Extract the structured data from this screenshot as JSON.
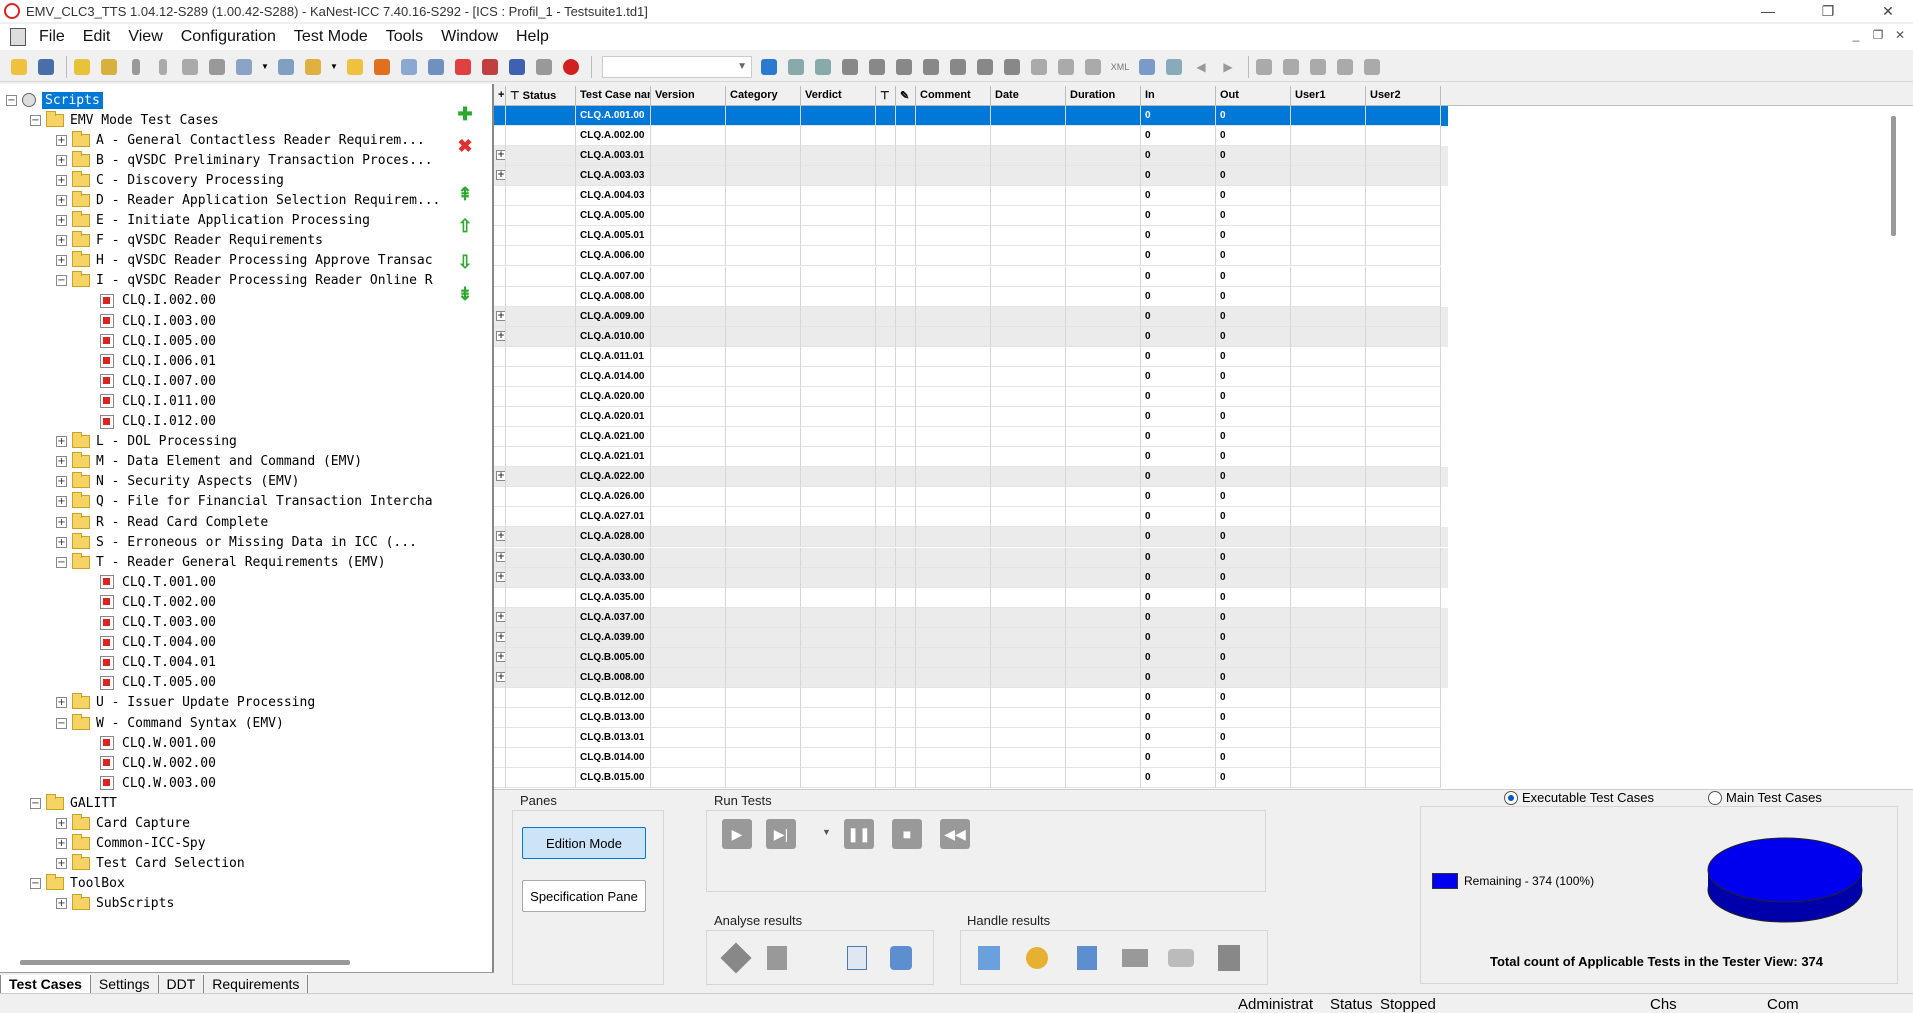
{
  "window": {
    "title": "EMV_CLC3_TTS 1.04.12-S289 (1.00.42-S288)  - KaNest-ICC 7.40.16-S292 - [ICS : Profil_1 - Testsuite1.td1]",
    "controls": {
      "minimize": "—",
      "maximize": "❐",
      "close": "✕"
    }
  },
  "menu": [
    "File",
    "Edit",
    "View",
    "Configuration",
    "Test Mode",
    "Tools",
    "Window",
    "Help"
  ],
  "mdi_controls": {
    "minimize": "_",
    "restore": "❐",
    "close": "✕"
  },
  "toolbar": {
    "combo_value": "",
    "combo_arrow": "▼"
  },
  "tree": {
    "root": "Scripts",
    "nodes": [
      {
        "label": "EMV Mode Test Cases",
        "level": 1,
        "kind": "folder",
        "toggle": "-"
      },
      {
        "label": "A - General Contactless Reader Requirem...",
        "level": 2,
        "kind": "folder",
        "toggle": "+"
      },
      {
        "label": "B - qVSDC Preliminary Transaction Proces...",
        "level": 2,
        "kind": "folder",
        "toggle": "+"
      },
      {
        "label": "C - Discovery Processing",
        "level": 2,
        "kind": "folder",
        "toggle": "+"
      },
      {
        "label": "D - Reader Application Selection Requirem...",
        "level": 2,
        "kind": "folder",
        "toggle": "+"
      },
      {
        "label": "E - Initiate Application Processing",
        "level": 2,
        "kind": "folder",
        "toggle": "+"
      },
      {
        "label": "F - qVSDC Reader Requirements",
        "level": 2,
        "kind": "folder",
        "toggle": "+"
      },
      {
        "label": "H - qVSDC Reader Processing Approve Transac",
        "level": 2,
        "kind": "folder",
        "toggle": "+"
      },
      {
        "label": "I - qVSDC Reader Processing Reader Online R",
        "level": 2,
        "kind": "folder",
        "toggle": "-"
      },
      {
        "label": "CLQ.I.002.00",
        "level": 3,
        "kind": "script"
      },
      {
        "label": "CLQ.I.003.00",
        "level": 3,
        "kind": "script"
      },
      {
        "label": "CLQ.I.005.00",
        "level": 3,
        "kind": "script"
      },
      {
        "label": "CLQ.I.006.01",
        "level": 3,
        "kind": "script"
      },
      {
        "label": "CLQ.I.007.00",
        "level": 3,
        "kind": "script"
      },
      {
        "label": "CLQ.I.011.00",
        "level": 3,
        "kind": "script"
      },
      {
        "label": "CLQ.I.012.00",
        "level": 3,
        "kind": "script"
      },
      {
        "label": "L - DOL Processing",
        "level": 2,
        "kind": "folder",
        "toggle": "+"
      },
      {
        "label": "M - Data Element and Command (EMV)",
        "level": 2,
        "kind": "folder",
        "toggle": "+"
      },
      {
        "label": "N - Security Aspects (EMV)",
        "level": 2,
        "kind": "folder",
        "toggle": "+"
      },
      {
        "label": "Q - File for Financial Transaction Intercha",
        "level": 2,
        "kind": "folder",
        "toggle": "+"
      },
      {
        "label": "R - Read Card Complete",
        "level": 2,
        "kind": "folder",
        "toggle": "+"
      },
      {
        "label": "S - Erroneous or Missing Data in ICC (...",
        "level": 2,
        "kind": "folder",
        "toggle": "+"
      },
      {
        "label": "T - Reader General Requirements (EMV)",
        "level": 2,
        "kind": "folder",
        "toggle": "-"
      },
      {
        "label": "CLQ.T.001.00",
        "level": 3,
        "kind": "script"
      },
      {
        "label": "CLQ.T.002.00",
        "level": 3,
        "kind": "script"
      },
      {
        "label": "CLQ.T.003.00",
        "level": 3,
        "kind": "script"
      },
      {
        "label": "CLQ.T.004.00",
        "level": 3,
        "kind": "script"
      },
      {
        "label": "CLQ.T.004.01",
        "level": 3,
        "kind": "script"
      },
      {
        "label": "CLQ.T.005.00",
        "level": 3,
        "kind": "script"
      },
      {
        "label": "U - Issuer Update Processing",
        "level": 2,
        "kind": "folder",
        "toggle": "+"
      },
      {
        "label": "W - Command Syntax (EMV)",
        "level": 2,
        "kind": "folder",
        "toggle": "-"
      },
      {
        "label": "CLQ.W.001.00",
        "level": 3,
        "kind": "script"
      },
      {
        "label": "CLQ.W.002.00",
        "level": 3,
        "kind": "script"
      },
      {
        "label": "CLQ.W.003.00",
        "level": 3,
        "kind": "script"
      },
      {
        "label": "GALITT",
        "level": 1,
        "kind": "folder",
        "toggle": "-"
      },
      {
        "label": "Card Capture",
        "level": 2,
        "kind": "folder",
        "toggle": "+"
      },
      {
        "label": "Common-ICC-Spy",
        "level": 2,
        "kind": "folder",
        "toggle": "+"
      },
      {
        "label": "Test Card Selection",
        "level": 2,
        "kind": "folder",
        "toggle": "+"
      },
      {
        "label": "ToolBox",
        "level": 1,
        "kind": "folder",
        "toggle": "-"
      },
      {
        "label": "SubScripts",
        "level": 2,
        "kind": "folder",
        "toggle": "+"
      }
    ]
  },
  "side_buttons": [
    {
      "name": "add-icon",
      "glyph": "✚",
      "color": "#2ea82e"
    },
    {
      "name": "delete-icon",
      "glyph": "✖",
      "color": "#e03030"
    },
    {
      "name": "move-top-icon",
      "glyph": "⇞",
      "color": "#2ea82e"
    },
    {
      "name": "move-up-icon",
      "glyph": "⇧",
      "color": "#2ea82e"
    },
    {
      "name": "move-down-icon",
      "glyph": "⇩",
      "color": "#2ea82e"
    },
    {
      "name": "move-bottom-icon",
      "glyph": "⇟",
      "color": "#2ea82e"
    }
  ],
  "left_tabs": [
    "Test Cases",
    "Settings",
    "DDT",
    "Requirements"
  ],
  "grid": {
    "columns": [
      "Status",
      "Test Case nan",
      "Version",
      "Category",
      "Verdict",
      "",
      "",
      "Comment",
      "Date",
      "Duration",
      "In",
      "Out",
      "User1",
      "User2"
    ],
    "rows": [
      {
        "name": "CLQ.A.001.00",
        "in": "0",
        "out": "0",
        "exp": false,
        "selected": true
      },
      {
        "name": "CLQ.A.002.00",
        "in": "0",
        "out": "0",
        "exp": false
      },
      {
        "name": "CLQ.A.003.01",
        "in": "0",
        "out": "0",
        "exp": true
      },
      {
        "name": "CLQ.A.003.03",
        "in": "0",
        "out": "0",
        "exp": true
      },
      {
        "name": "CLQ.A.004.03",
        "in": "0",
        "out": "0",
        "exp": false
      },
      {
        "name": "CLQ.A.005.00",
        "in": "0",
        "out": "0",
        "exp": false
      },
      {
        "name": "CLQ.A.005.01",
        "in": "0",
        "out": "0",
        "exp": false
      },
      {
        "name": "CLQ.A.006.00",
        "in": "0",
        "out": "0",
        "exp": false
      },
      {
        "name": "CLQ.A.007.00",
        "in": "0",
        "out": "0",
        "exp": false
      },
      {
        "name": "CLQ.A.008.00",
        "in": "0",
        "out": "0",
        "exp": false
      },
      {
        "name": "CLQ.A.009.00",
        "in": "0",
        "out": "0",
        "exp": true
      },
      {
        "name": "CLQ.A.010.00",
        "in": "0",
        "out": "0",
        "exp": true
      },
      {
        "name": "CLQ.A.011.01",
        "in": "0",
        "out": "0",
        "exp": false
      },
      {
        "name": "CLQ.A.014.00",
        "in": "0",
        "out": "0",
        "exp": false
      },
      {
        "name": "CLQ.A.020.00",
        "in": "0",
        "out": "0",
        "exp": false
      },
      {
        "name": "CLQ.A.020.01",
        "in": "0",
        "out": "0",
        "exp": false
      },
      {
        "name": "CLQ.A.021.00",
        "in": "0",
        "out": "0",
        "exp": false
      },
      {
        "name": "CLQ.A.021.01",
        "in": "0",
        "out": "0",
        "exp": false
      },
      {
        "name": "CLQ.A.022.00",
        "in": "0",
        "out": "0",
        "exp": true
      },
      {
        "name": "CLQ.A.026.00",
        "in": "0",
        "out": "0",
        "exp": false
      },
      {
        "name": "CLQ.A.027.01",
        "in": "0",
        "out": "0",
        "exp": false
      },
      {
        "name": "CLQ.A.028.00",
        "in": "0",
        "out": "0",
        "exp": true
      },
      {
        "name": "CLQ.A.030.00",
        "in": "0",
        "out": "0",
        "exp": true
      },
      {
        "name": "CLQ.A.033.00",
        "in": "0",
        "out": "0",
        "exp": true
      },
      {
        "name": "CLQ.A.035.00",
        "in": "0",
        "out": "0",
        "exp": false
      },
      {
        "name": "CLQ.A.037.00",
        "in": "0",
        "out": "0",
        "exp": true
      },
      {
        "name": "CLQ.A.039.00",
        "in": "0",
        "out": "0",
        "exp": true
      },
      {
        "name": "CLQ.B.005.00",
        "in": "0",
        "out": "0",
        "exp": true
      },
      {
        "name": "CLQ.B.008.00",
        "in": "0",
        "out": "0",
        "exp": true
      },
      {
        "name": "CLQ.B.012.00",
        "in": "0",
        "out": "0",
        "exp": false
      },
      {
        "name": "CLQ.B.013.00",
        "in": "0",
        "out": "0",
        "exp": false
      },
      {
        "name": "CLQ.B.013.01",
        "in": "0",
        "out": "0",
        "exp": false
      },
      {
        "name": "CLQ.B.014.00",
        "in": "0",
        "out": "0",
        "exp": false
      },
      {
        "name": "CLQ.B.015.00",
        "in": "0",
        "out": "0",
        "exp": false
      }
    ]
  },
  "panes": {
    "title": "Panes",
    "edition": "Edition Mode",
    "specification": "Specification Pane"
  },
  "run_tests": {
    "title": "Run Tests"
  },
  "analyse": {
    "title": "Analyse results"
  },
  "handle": {
    "title": "Handle results"
  },
  "summary": {
    "radio_executable": "Executable Test Cases",
    "radio_main": "Main Test Cases",
    "legend": "Remaining - 374 (100%)",
    "total": "Total count of Applicable Tests in the Tester View: 374",
    "remaining_fraction": 1.0,
    "color": "#0000ee"
  },
  "status": {
    "user": "Administrat",
    "status_label": "Status",
    "status_value": "Stopped",
    "lang": "Chs",
    "port": "Com"
  }
}
